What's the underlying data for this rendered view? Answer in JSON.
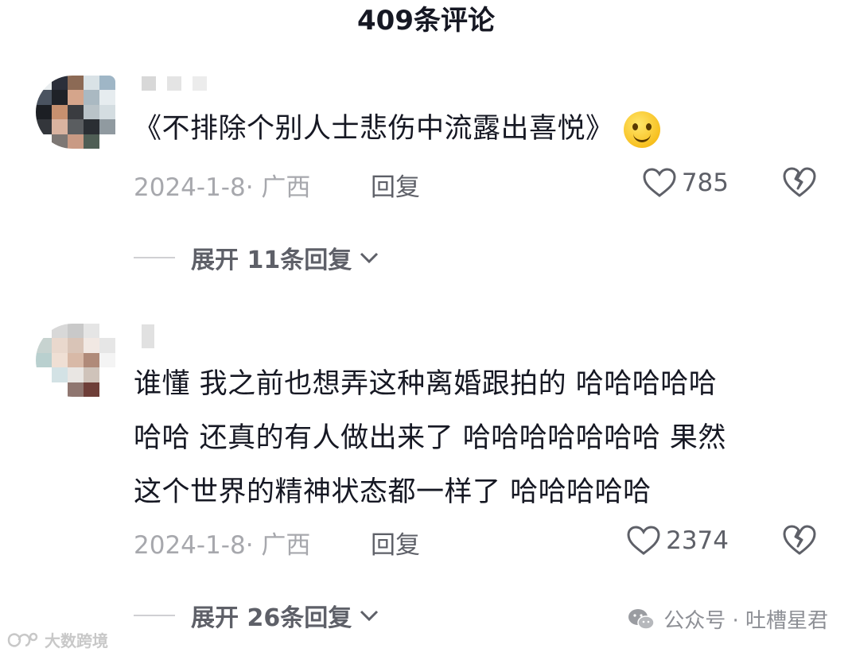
{
  "header": {
    "title": "409条评论"
  },
  "comments": [
    {
      "content_lines": [
        "《不排除个别人士悲伤中流露出喜悦》"
      ],
      "date": "2024-1-8· 广西",
      "reply_label": "回复",
      "likes": "785",
      "expand_label": "展开 11条回复"
    },
    {
      "content_lines": [
        "谁懂 我之前也想弄这种离婚跟拍的 哈哈哈哈哈",
        "哈哈 还真的有人做出来了 哈哈哈哈哈哈哈 果然",
        "这个世界的精神状态都一样了 哈哈哈哈哈"
      ],
      "date": "2024-1-8· 广西",
      "reply_label": "回复",
      "likes": "2374",
      "expand_label": "展开 26条回复"
    }
  ],
  "watermarks": {
    "left": "大数跨境",
    "right": "公众号 · 吐槽星君"
  },
  "colors": {
    "text": "#161823",
    "meta": "#a7a8ad",
    "action": "#5e6068"
  }
}
